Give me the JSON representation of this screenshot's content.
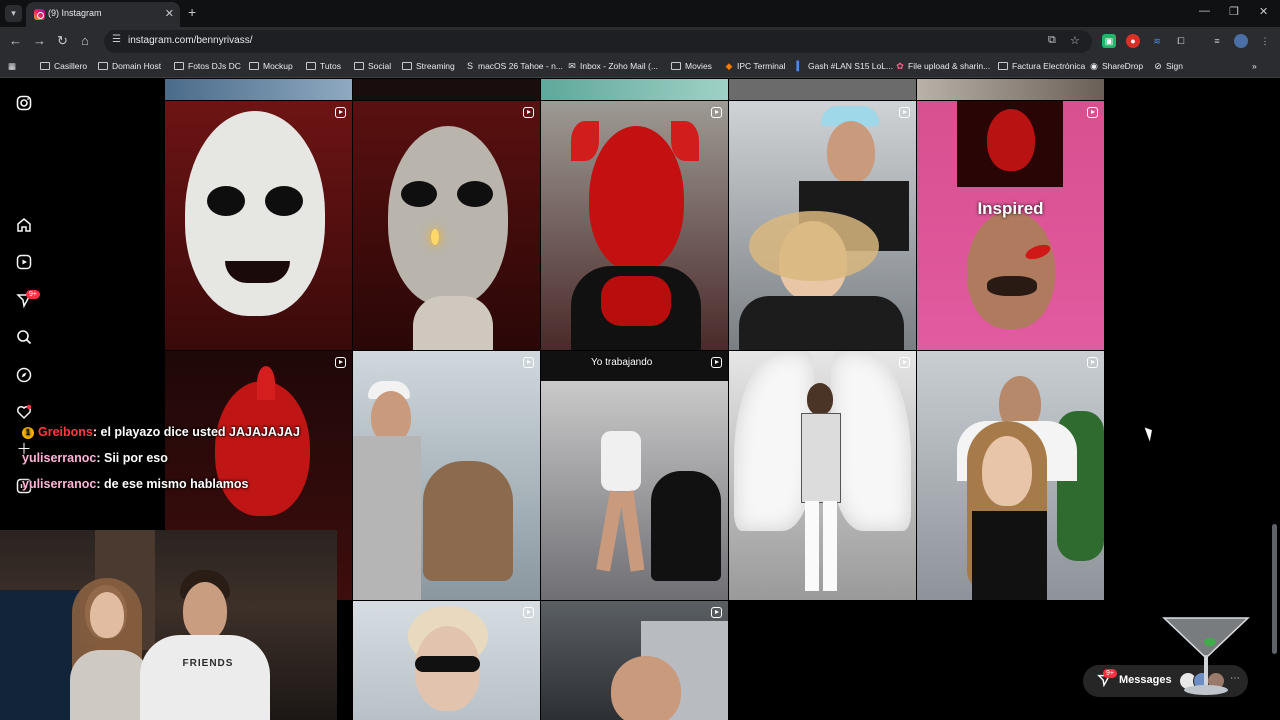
{
  "browser": {
    "tab": {
      "title": "(9) Instagram"
    },
    "url": "instagram.com/bennyrivass/",
    "bookmarks": [
      {
        "label": "Casillero",
        "icon": "folder-icon"
      },
      {
        "label": "Domain Host",
        "icon": "folder-icon"
      },
      {
        "label": "Fotos DJs DC",
        "icon": "folder-icon"
      },
      {
        "label": "Mockup",
        "icon": "folder-icon"
      },
      {
        "label": "Tutos",
        "icon": "folder-icon"
      },
      {
        "label": "Social",
        "icon": "folder-icon"
      },
      {
        "label": "Streaming",
        "icon": "folder-icon"
      },
      {
        "label": "macOS 26 Tahoe - n...",
        "icon": "s-icon"
      },
      {
        "label": "Inbox - Zoho Mail (...",
        "icon": "mail-icon"
      },
      {
        "label": "Movies",
        "icon": "folder-icon"
      },
      {
        "label": "IPC Terminal",
        "icon": "shield-icon"
      },
      {
        "label": "Gash #LAN S15 LoL...",
        "icon": "bookmark-icon"
      },
      {
        "label": "File upload & sharin...",
        "icon": "upload-icon"
      },
      {
        "label": "Factura Electrónica",
        "icon": "folder-icon"
      },
      {
        "label": "ShareDrop",
        "icon": "share-icon"
      },
      {
        "label": "Sign",
        "icon": "sign-icon"
      }
    ]
  },
  "instagram": {
    "notifications_count": "9+",
    "posts": [
      {
        "id": "p1",
        "overlay": ""
      },
      {
        "id": "p2",
        "overlay": ""
      },
      {
        "id": "p3",
        "overlay": ""
      },
      {
        "id": "p4",
        "overlay": ""
      },
      {
        "id": "p5",
        "overlay": "Inspired"
      },
      {
        "id": "p6",
        "overlay": ""
      },
      {
        "id": "p7",
        "overlay": ""
      },
      {
        "id": "p8",
        "overlay": "Yo trabajando"
      },
      {
        "id": "p9",
        "overlay": ""
      },
      {
        "id": "p10",
        "overlay": ""
      }
    ],
    "messages": {
      "label": "Messages",
      "badge": "9+"
    }
  },
  "chat": [
    {
      "user": "Greibons",
      "text": ": el playazo dice usted JAJAJAJAJ",
      "badge": "1"
    },
    {
      "user": "yuliserranoc",
      "text": ": Sii por eso"
    },
    {
      "user": "yuliserranoc",
      "text": ": de ese mismo hablamos"
    }
  ],
  "webcam": {
    "shirt_text": "FRIENDS"
  }
}
